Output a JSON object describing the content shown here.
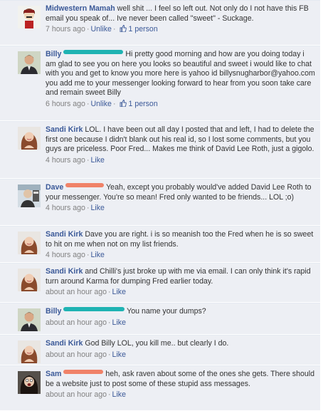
{
  "comments": [
    {
      "author": "Midwestern Mamah",
      "avatar": "woman-avatar-icon",
      "text": "well shit ... I feel so left out. Not only do I not have this FB email you speak of... Ive never been called \"sweet\" - Suckage.",
      "time": "7 hours ago",
      "action": "Unlike",
      "likes": "1 person"
    },
    {
      "author": "Billy",
      "avatar": "man-avatar-icon",
      "text": "Hi pretty good morning and how are you doing today i am glad to see you on here you looks so beautiful and sweet i would like to chat with you and get to know you more here is yahoo id billysnugharbor@yahoo.com you add me to your messenger looking forward to hear from you soon take care and remain sweet Billy",
      "time": "6 hours ago",
      "action": "Unlike",
      "likes": "1 person"
    },
    {
      "author": "Sandi Kirk",
      "avatar": "woman-avatar-icon",
      "text": "LOL. I have been out all day I posted that and left, I had to delete the first one because I didn't blank out his real id, so I lost some comments, but you guys are priceless. Poor Fred... Makes me think of David Lee Roth, just a gigolo.",
      "time": "4 hours ago",
      "action": "Like"
    },
    {
      "author": "Dave",
      "avatar": "man-avatar-icon",
      "text": "Yeah, except you probably would've added David Lee Roth to your messenger. You're so mean! Fred only wanted to be friends... LOL ;o)",
      "time": "4 hours ago",
      "action": "Like"
    },
    {
      "author": "Sandi Kirk",
      "avatar": "woman-avatar-icon",
      "text": "Dave you are right. i is so meanish too the Fred when he is so sweet to hit on me when not on my list friends.",
      "time": "4 hours ago",
      "action": "Like"
    },
    {
      "author": "Sandi Kirk",
      "avatar": "woman-avatar-icon",
      "text": "and Chilli's just broke up with me via email. I can only think it's rapid turn around Karma for dumping Fred earlier today.",
      "time": "about an hour ago",
      "action": "Like"
    },
    {
      "author": "Billy",
      "avatar": "man-avatar-icon",
      "text": "You name your dumps?",
      "time": "about an hour ago",
      "action": "Like"
    },
    {
      "author": "Sandi Kirk",
      "avatar": "woman-avatar-icon",
      "text": "God Billy LOL, you kill me.. but clearly I do.",
      "time": "about an hour ago",
      "action": "Like"
    },
    {
      "author": "Sam",
      "avatar": "woman-avatar-icon",
      "text": "heh, ask raven about some of the ones she gets. There should be a website just to post some of these stupid ass messages.",
      "time": "about an hour ago",
      "action": "Like"
    }
  ]
}
